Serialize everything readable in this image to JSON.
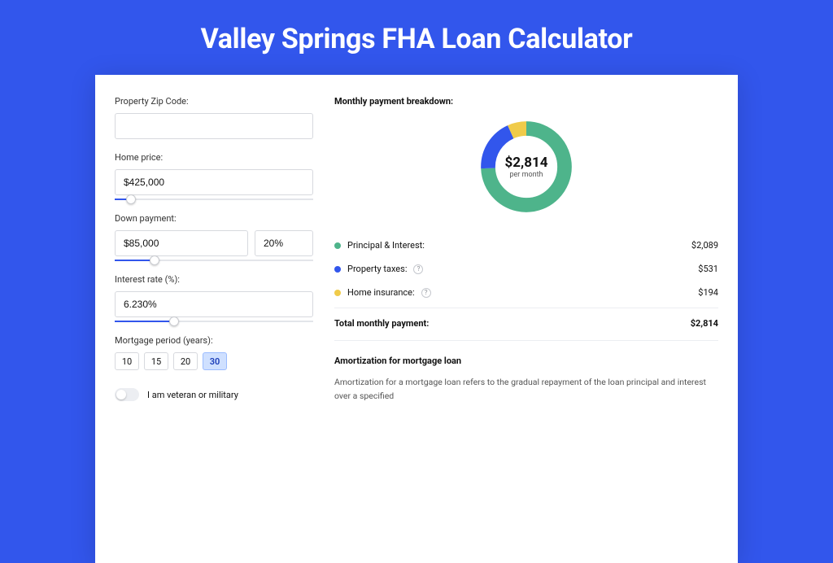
{
  "title": "Valley Springs FHA Loan Calculator",
  "form": {
    "zip_label": "Property Zip Code:",
    "zip_value": "",
    "home_price_label": "Home price:",
    "home_price_value": "$425,000",
    "home_price_slider_pct": 8,
    "down_payment_label": "Down payment:",
    "down_payment_value": "$85,000",
    "down_payment_pct": "20%",
    "down_payment_slider_pct": 20,
    "interest_label": "Interest rate (%):",
    "interest_value": "6.230%",
    "interest_slider_pct": 30,
    "period_label": "Mortgage period (years):",
    "periods": [
      "10",
      "15",
      "20",
      "30"
    ],
    "period_active_index": 3,
    "veteran_label": "I am veteran or military",
    "veteran_on": false
  },
  "breakdown": {
    "title": "Monthly payment breakdown:",
    "donut_amount": "$2,814",
    "donut_sub": "per month",
    "items": [
      {
        "label": "Principal & Interest:",
        "value": "$2,089",
        "color": "green",
        "help": false
      },
      {
        "label": "Property taxes:",
        "value": "$531",
        "color": "blue",
        "help": true
      },
      {
        "label": "Home insurance:",
        "value": "$194",
        "color": "yellow",
        "help": true
      }
    ],
    "total_label": "Total monthly payment:",
    "total_value": "$2,814"
  },
  "amortization": {
    "title": "Amortization for mortgage loan",
    "text": "Amortization for a mortgage loan refers to the gradual repayment of the loan principal and interest over a specified"
  },
  "chart_data": {
    "type": "pie",
    "title": "Monthly payment breakdown",
    "series": [
      {
        "name": "Principal & Interest",
        "value": 2089,
        "color": "#4eb48b"
      },
      {
        "name": "Property taxes",
        "value": 531,
        "color": "#3256ec"
      },
      {
        "name": "Home insurance",
        "value": 194,
        "color": "#f0cb4a"
      }
    ],
    "total": 2814,
    "center_label": "$2,814 per month"
  }
}
